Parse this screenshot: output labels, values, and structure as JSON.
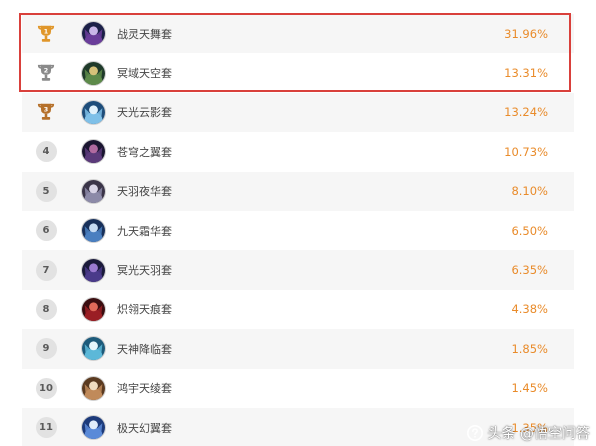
{
  "ranking": {
    "items": [
      {
        "rank": "1",
        "medal": "gold",
        "name": "战灵天舞套",
        "pct": "31.96%",
        "avatar_colors": [
          "#1c2048",
          "#6a3d9a",
          "#c9b6e8"
        ]
      },
      {
        "rank": "2",
        "medal": "silver",
        "name": "冥域天空套",
        "pct": "13.31%",
        "avatar_colors": [
          "#1f3a2a",
          "#5d8a4a",
          "#d6c27a"
        ]
      },
      {
        "rank": "3",
        "medal": "bronze",
        "name": "天光云影套",
        "pct": "13.24%",
        "avatar_colors": [
          "#1e4d7a",
          "#7fc0e8",
          "#e3f2fb"
        ]
      },
      {
        "rank": "4",
        "medal": "",
        "name": "苍穹之翼套",
        "pct": "10.73%",
        "avatar_colors": [
          "#1a1530",
          "#5b3a7a",
          "#b06aa0"
        ]
      },
      {
        "rank": "5",
        "medal": "",
        "name": "天羽夜华套",
        "pct": "8.10%",
        "avatar_colors": [
          "#3a3448",
          "#8c8aa8",
          "#d8d4e6"
        ]
      },
      {
        "rank": "6",
        "medal": "",
        "name": "九天霜华套",
        "pct": "6.50%",
        "avatar_colors": [
          "#18305a",
          "#4a7fc0",
          "#c6dcf4"
        ]
      },
      {
        "rank": "7",
        "medal": "",
        "name": "冥光天羽套",
        "pct": "6.35%",
        "avatar_colors": [
          "#1a1a3a",
          "#4a3a8a",
          "#9a7ad0"
        ]
      },
      {
        "rank": "8",
        "medal": "",
        "name": "炽翎天痕套",
        "pct": "4.38%",
        "avatar_colors": [
          "#3a0d10",
          "#9a1e24",
          "#e06a5a"
        ]
      },
      {
        "rank": "9",
        "medal": "",
        "name": "天神降临套",
        "pct": "1.85%",
        "avatar_colors": [
          "#1d5a7a",
          "#5cb8d8",
          "#e6f6fc"
        ]
      },
      {
        "rank": "10",
        "medal": "",
        "name": "鸿宇天绫套",
        "pct": "1.45%",
        "avatar_colors": [
          "#5a3a20",
          "#c08a5a",
          "#f0dcc0"
        ]
      },
      {
        "rank": "11",
        "medal": "",
        "name": "极天幻翼套",
        "pct": "1.35%",
        "avatar_colors": [
          "#1c3a7a",
          "#5a8ad8",
          "#e0ecfa"
        ]
      }
    ]
  },
  "colors": {
    "percent": "#e98b2a",
    "highlight": "#d9403b",
    "gold": "#e0962a",
    "silver": "#8a8a8a",
    "bronze": "#b5702a"
  },
  "watermark": {
    "icon": "question-bubble-icon",
    "text": "头条 @悟空问答"
  }
}
